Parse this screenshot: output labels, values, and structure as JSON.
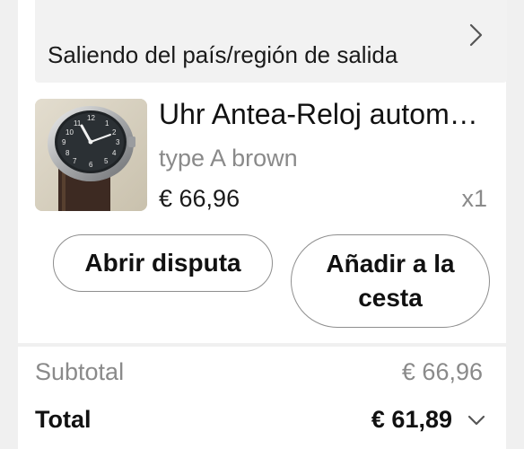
{
  "status": {
    "text": "Saliendo del país/región de salida",
    "icon": "chevron-right-icon"
  },
  "product": {
    "title": "Uhr Antea-Reloj autom…",
    "variant": "type A brown",
    "price": "€ 66,96",
    "quantity": "x1",
    "image": "wristwatch-photo"
  },
  "actions": {
    "dispute_label": "Abrir disputa",
    "cart_label": "Añadir a la cesta"
  },
  "summary": {
    "subtotal_label": "Subtotal",
    "subtotal_value": "€ 66,96",
    "total_label": "Total",
    "total_value": "€ 61,89",
    "expand_icon": "chevron-down-icon"
  },
  "colors": {
    "background": "#f0f0f0",
    "card": "#ffffff",
    "status_bg": "#f2f2f2",
    "text_primary": "#111111",
    "text_secondary": "#8a8a8a",
    "button_border": "#8e8e8e"
  }
}
